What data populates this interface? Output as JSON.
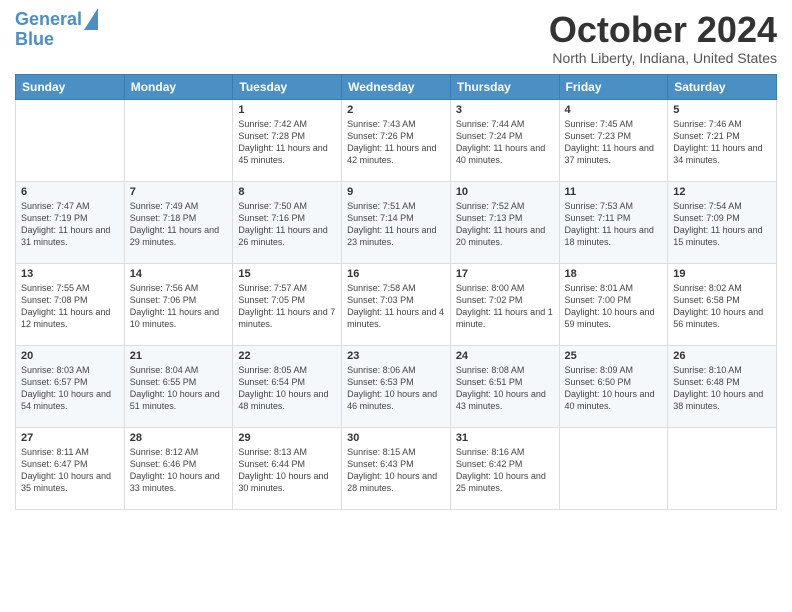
{
  "logo": {
    "line1": "General",
    "line2": "Blue"
  },
  "title": "October 2024",
  "location": "North Liberty, Indiana, United States",
  "days_header": [
    "Sunday",
    "Monday",
    "Tuesday",
    "Wednesday",
    "Thursday",
    "Friday",
    "Saturday"
  ],
  "weeks": [
    [
      {
        "day": "",
        "info": ""
      },
      {
        "day": "",
        "info": ""
      },
      {
        "day": "1",
        "info": "Sunrise: 7:42 AM\nSunset: 7:28 PM\nDaylight: 11 hours and 45 minutes."
      },
      {
        "day": "2",
        "info": "Sunrise: 7:43 AM\nSunset: 7:26 PM\nDaylight: 11 hours and 42 minutes."
      },
      {
        "day": "3",
        "info": "Sunrise: 7:44 AM\nSunset: 7:24 PM\nDaylight: 11 hours and 40 minutes."
      },
      {
        "day": "4",
        "info": "Sunrise: 7:45 AM\nSunset: 7:23 PM\nDaylight: 11 hours and 37 minutes."
      },
      {
        "day": "5",
        "info": "Sunrise: 7:46 AM\nSunset: 7:21 PM\nDaylight: 11 hours and 34 minutes."
      }
    ],
    [
      {
        "day": "6",
        "info": "Sunrise: 7:47 AM\nSunset: 7:19 PM\nDaylight: 11 hours and 31 minutes."
      },
      {
        "day": "7",
        "info": "Sunrise: 7:49 AM\nSunset: 7:18 PM\nDaylight: 11 hours and 29 minutes."
      },
      {
        "day": "8",
        "info": "Sunrise: 7:50 AM\nSunset: 7:16 PM\nDaylight: 11 hours and 26 minutes."
      },
      {
        "day": "9",
        "info": "Sunrise: 7:51 AM\nSunset: 7:14 PM\nDaylight: 11 hours and 23 minutes."
      },
      {
        "day": "10",
        "info": "Sunrise: 7:52 AM\nSunset: 7:13 PM\nDaylight: 11 hours and 20 minutes."
      },
      {
        "day": "11",
        "info": "Sunrise: 7:53 AM\nSunset: 7:11 PM\nDaylight: 11 hours and 18 minutes."
      },
      {
        "day": "12",
        "info": "Sunrise: 7:54 AM\nSunset: 7:09 PM\nDaylight: 11 hours and 15 minutes."
      }
    ],
    [
      {
        "day": "13",
        "info": "Sunrise: 7:55 AM\nSunset: 7:08 PM\nDaylight: 11 hours and 12 minutes."
      },
      {
        "day": "14",
        "info": "Sunrise: 7:56 AM\nSunset: 7:06 PM\nDaylight: 11 hours and 10 minutes."
      },
      {
        "day": "15",
        "info": "Sunrise: 7:57 AM\nSunset: 7:05 PM\nDaylight: 11 hours and 7 minutes."
      },
      {
        "day": "16",
        "info": "Sunrise: 7:58 AM\nSunset: 7:03 PM\nDaylight: 11 hours and 4 minutes."
      },
      {
        "day": "17",
        "info": "Sunrise: 8:00 AM\nSunset: 7:02 PM\nDaylight: 11 hours and 1 minute."
      },
      {
        "day": "18",
        "info": "Sunrise: 8:01 AM\nSunset: 7:00 PM\nDaylight: 10 hours and 59 minutes."
      },
      {
        "day": "19",
        "info": "Sunrise: 8:02 AM\nSunset: 6:58 PM\nDaylight: 10 hours and 56 minutes."
      }
    ],
    [
      {
        "day": "20",
        "info": "Sunrise: 8:03 AM\nSunset: 6:57 PM\nDaylight: 10 hours and 54 minutes."
      },
      {
        "day": "21",
        "info": "Sunrise: 8:04 AM\nSunset: 6:55 PM\nDaylight: 10 hours and 51 minutes."
      },
      {
        "day": "22",
        "info": "Sunrise: 8:05 AM\nSunset: 6:54 PM\nDaylight: 10 hours and 48 minutes."
      },
      {
        "day": "23",
        "info": "Sunrise: 8:06 AM\nSunset: 6:53 PM\nDaylight: 10 hours and 46 minutes."
      },
      {
        "day": "24",
        "info": "Sunrise: 8:08 AM\nSunset: 6:51 PM\nDaylight: 10 hours and 43 minutes."
      },
      {
        "day": "25",
        "info": "Sunrise: 8:09 AM\nSunset: 6:50 PM\nDaylight: 10 hours and 40 minutes."
      },
      {
        "day": "26",
        "info": "Sunrise: 8:10 AM\nSunset: 6:48 PM\nDaylight: 10 hours and 38 minutes."
      }
    ],
    [
      {
        "day": "27",
        "info": "Sunrise: 8:11 AM\nSunset: 6:47 PM\nDaylight: 10 hours and 35 minutes."
      },
      {
        "day": "28",
        "info": "Sunrise: 8:12 AM\nSunset: 6:46 PM\nDaylight: 10 hours and 33 minutes."
      },
      {
        "day": "29",
        "info": "Sunrise: 8:13 AM\nSunset: 6:44 PM\nDaylight: 10 hours and 30 minutes."
      },
      {
        "day": "30",
        "info": "Sunrise: 8:15 AM\nSunset: 6:43 PM\nDaylight: 10 hours and 28 minutes."
      },
      {
        "day": "31",
        "info": "Sunrise: 8:16 AM\nSunset: 6:42 PM\nDaylight: 10 hours and 25 minutes."
      },
      {
        "day": "",
        "info": ""
      },
      {
        "day": "",
        "info": ""
      }
    ]
  ]
}
